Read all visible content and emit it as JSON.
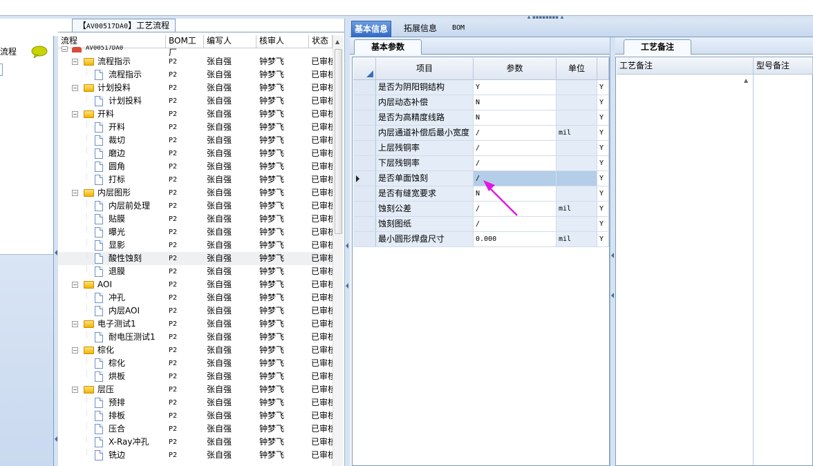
{
  "window": {
    "tree_title_prefix": "【",
    "tree_title_code": "AV00517DA0",
    "tree_title_suffix": "】工艺流程"
  },
  "left_panel": {
    "label": "流程"
  },
  "tree": {
    "headers": [
      "流程",
      "BOM工厂",
      "编写人",
      "核审人",
      "状态"
    ],
    "root": "AV00517DA0",
    "rows": [
      {
        "name": "流程指示",
        "type": "folder",
        "level": 1,
        "factory": "P2",
        "writer": "张自强",
        "reviewer": "钟梦飞",
        "status": "已审核"
      },
      {
        "name": "流程指示",
        "type": "doc",
        "level": 2,
        "factory": "P2",
        "writer": "张自强",
        "reviewer": "钟梦飞",
        "status": "已审核"
      },
      {
        "name": "计划投料",
        "type": "folder",
        "level": 1,
        "factory": "P2",
        "writer": "张自强",
        "reviewer": "钟梦飞",
        "status": "已审核"
      },
      {
        "name": "计划投料",
        "type": "doc",
        "level": 2,
        "factory": "P2",
        "writer": "张自强",
        "reviewer": "钟梦飞",
        "status": "已审核"
      },
      {
        "name": "开料",
        "type": "folder",
        "level": 1,
        "factory": "P2",
        "writer": "张自强",
        "reviewer": "钟梦飞",
        "status": "已审核"
      },
      {
        "name": "开料",
        "type": "doc",
        "level": 2,
        "factory": "P2",
        "writer": "张自强",
        "reviewer": "钟梦飞",
        "status": "已审核"
      },
      {
        "name": "裁切",
        "type": "doc",
        "level": 2,
        "factory": "P2",
        "writer": "张自强",
        "reviewer": "钟梦飞",
        "status": "已审核"
      },
      {
        "name": "磨边",
        "type": "doc",
        "level": 2,
        "factory": "P2",
        "writer": "张自强",
        "reviewer": "钟梦飞",
        "status": "已审核"
      },
      {
        "name": "圆角",
        "type": "doc",
        "level": 2,
        "factory": "P2",
        "writer": "张自强",
        "reviewer": "钟梦飞",
        "status": "已审核"
      },
      {
        "name": "打标",
        "type": "doc",
        "level": 2,
        "factory": "P2",
        "writer": "张自强",
        "reviewer": "钟梦飞",
        "status": "已审核"
      },
      {
        "name": "内层图形",
        "type": "folder",
        "level": 1,
        "factory": "P2",
        "writer": "张自强",
        "reviewer": "钟梦飞",
        "status": "已审核"
      },
      {
        "name": "内层前处理",
        "type": "doc",
        "level": 2,
        "factory": "P2",
        "writer": "张自强",
        "reviewer": "钟梦飞",
        "status": "已审核"
      },
      {
        "name": "贴膜",
        "type": "doc",
        "level": 2,
        "factory": "P2",
        "writer": "张自强",
        "reviewer": "钟梦飞",
        "status": "已审核"
      },
      {
        "name": "曝光",
        "type": "doc",
        "level": 2,
        "factory": "P2",
        "writer": "张自强",
        "reviewer": "钟梦飞",
        "status": "已审核"
      },
      {
        "name": "显影",
        "type": "doc",
        "level": 2,
        "factory": "P2",
        "writer": "张自强",
        "reviewer": "钟梦飞",
        "status": "已审核"
      },
      {
        "name": "酸性蚀刻",
        "type": "doc",
        "level": 2,
        "factory": "P2",
        "writer": "张自强",
        "reviewer": "钟梦飞",
        "status": "已审核",
        "selected": true
      },
      {
        "name": "退膜",
        "type": "doc",
        "level": 2,
        "factory": "P2",
        "writer": "张自强",
        "reviewer": "钟梦飞",
        "status": "已审核"
      },
      {
        "name": "AOI",
        "type": "folder",
        "level": 1,
        "factory": "P2",
        "writer": "张自强",
        "reviewer": "钟梦飞",
        "status": "已审核"
      },
      {
        "name": "冲孔",
        "type": "doc",
        "level": 2,
        "factory": "P2",
        "writer": "张自强",
        "reviewer": "钟梦飞",
        "status": "已审核"
      },
      {
        "name": "内层AOI",
        "type": "doc",
        "level": 2,
        "factory": "P2",
        "writer": "张自强",
        "reviewer": "钟梦飞",
        "status": "已审核"
      },
      {
        "name": "电子测试1",
        "type": "folder",
        "level": 1,
        "factory": "P2",
        "writer": "张自强",
        "reviewer": "钟梦飞",
        "status": "已审核"
      },
      {
        "name": "耐电压测试1",
        "type": "doc",
        "level": 2,
        "factory": "P2",
        "writer": "张自强",
        "reviewer": "钟梦飞",
        "status": "已审核"
      },
      {
        "name": "棕化",
        "type": "folder",
        "level": 1,
        "factory": "P2",
        "writer": "张自强",
        "reviewer": "钟梦飞",
        "status": "已审核"
      },
      {
        "name": "棕化",
        "type": "doc",
        "level": 2,
        "factory": "P2",
        "writer": "张自强",
        "reviewer": "钟梦飞",
        "status": "已审核"
      },
      {
        "name": "烘板",
        "type": "doc",
        "level": 2,
        "factory": "P2",
        "writer": "张自强",
        "reviewer": "钟梦飞",
        "status": "已审核"
      },
      {
        "name": "层压",
        "type": "folder",
        "level": 1,
        "factory": "P2",
        "writer": "张自强",
        "reviewer": "钟梦飞",
        "status": "已审核"
      },
      {
        "name": "预排",
        "type": "doc",
        "level": 2,
        "factory": "P2",
        "writer": "张自强",
        "reviewer": "钟梦飞",
        "status": "已审核"
      },
      {
        "name": "排板",
        "type": "doc",
        "level": 2,
        "factory": "P2",
        "writer": "张自强",
        "reviewer": "钟梦飞",
        "status": "已审核"
      },
      {
        "name": "压合",
        "type": "doc",
        "level": 2,
        "factory": "P2",
        "writer": "张自强",
        "reviewer": "钟梦飞",
        "status": "已审核"
      },
      {
        "name": "X-Ray冲孔",
        "type": "doc",
        "level": 2,
        "factory": "P2",
        "writer": "张自强",
        "reviewer": "钟梦飞",
        "status": "已审核"
      },
      {
        "name": "铣边",
        "type": "doc",
        "level": 2,
        "factory": "P2",
        "writer": "张自强",
        "reviewer": "钟梦飞",
        "status": "已审核"
      }
    ]
  },
  "tabs": {
    "items": [
      "基本信息",
      "拓展信息",
      "BOM"
    ],
    "active": 0
  },
  "basic": {
    "subtab": "基本参数",
    "headers": [
      "项目",
      "参数",
      "单位"
    ],
    "rows": [
      {
        "item": "是否为阴阳铜结构",
        "value": "Y",
        "unit": "",
        "flag": "Y"
      },
      {
        "item": "内层动态补偿",
        "value": "N",
        "unit": "",
        "flag": "Y"
      },
      {
        "item": "是否为高精度线路",
        "value": "N",
        "unit": "",
        "flag": "Y"
      },
      {
        "item": "内层通道补偿后最小宽度",
        "value": "/",
        "unit": "mil",
        "flag": "Y"
      },
      {
        "item": "上层残铜率",
        "value": "/",
        "unit": "",
        "flag": "Y"
      },
      {
        "item": "下层残铜率",
        "value": "/",
        "unit": "",
        "flag": "Y"
      },
      {
        "item": "是否单面蚀刻",
        "value": "/",
        "unit": "",
        "flag": "Y",
        "current": true
      },
      {
        "item": "是否有缝宽要求",
        "value": "N",
        "unit": "",
        "flag": "Y"
      },
      {
        "item": "蚀刻公差",
        "value": "/",
        "unit": "mil",
        "flag": "Y"
      },
      {
        "item": "蚀刻图纸",
        "value": "/",
        "unit": "",
        "flag": "Y"
      },
      {
        "item": "最小圆形焊盘尺寸",
        "value": "0.000",
        "unit": "mil",
        "flag": "Y"
      }
    ]
  },
  "notes": {
    "subtab": "工艺备注",
    "headers": [
      "工艺备注",
      "型号备注"
    ]
  },
  "colors": {
    "accent_tab": "#2f69c2",
    "annotation_arrow": "#e019e0",
    "selected_cell": "#b4cde9"
  }
}
